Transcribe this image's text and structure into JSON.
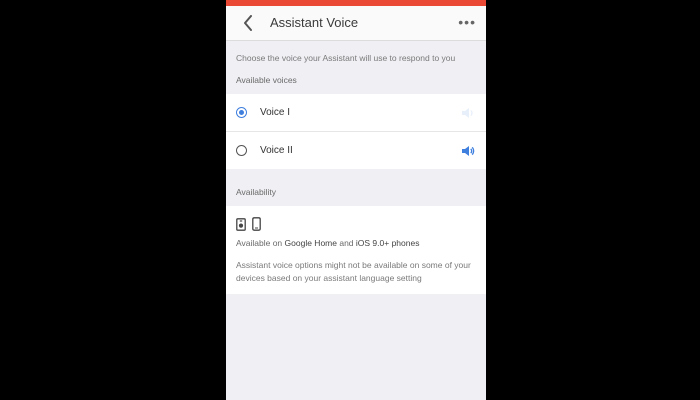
{
  "header": {
    "title": "Assistant Voice",
    "more_label": "•••"
  },
  "description": "Choose the voice your Assistant will use to respond to you",
  "voices": {
    "section_title": "Available voices",
    "items": [
      {
        "label": "Voice I",
        "selected": true
      },
      {
        "label": "Voice II",
        "selected": false
      }
    ]
  },
  "availability": {
    "section_title": "Availability",
    "text_prefix": "Available on ",
    "device_home": "Google Home",
    "text_and": " and ",
    "device_ios": "iOS 9.0+ phones",
    "note": "Assistant voice options might not be available on some of your devices based on your assistant language setting"
  },
  "colors": {
    "accent": "#3f7fde",
    "status_bar": "#ea4a35"
  },
  "icons": [
    "back-arrow-icon",
    "more-icon",
    "speaker-icon",
    "google-home-icon",
    "phone-icon"
  ]
}
